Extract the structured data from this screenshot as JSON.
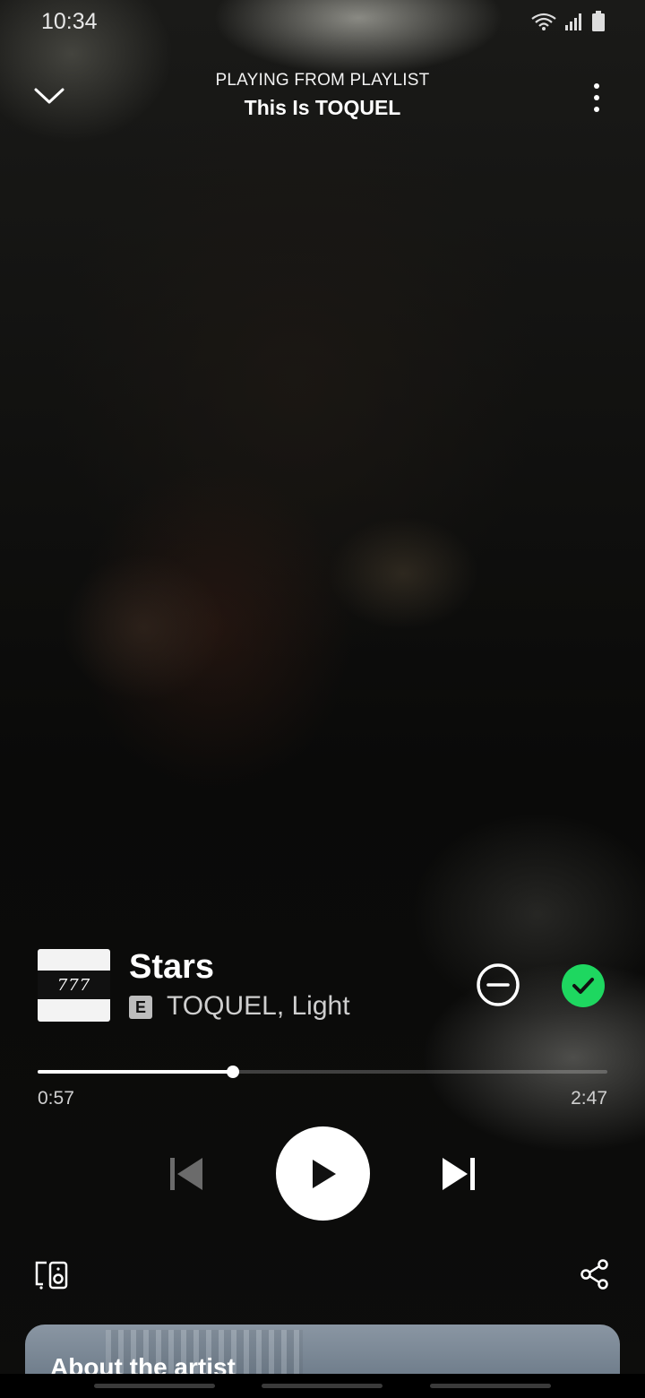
{
  "status_bar": {
    "time": "10:34",
    "icons": [
      "wifi-icon",
      "signal-icon",
      "battery-icon"
    ]
  },
  "header": {
    "context_label": "PLAYING FROM PLAYLIST",
    "context_title": "This Is TOQUEL",
    "collapse_icon": "chevron-down-icon",
    "menu_icon": "more-vertical-icon"
  },
  "track": {
    "art_text": "777",
    "title": "Stars",
    "explicit_badge": "E",
    "artists": "TOQUEL, Light"
  },
  "progress": {
    "elapsed": "0:57",
    "total": "2:47",
    "fraction": 0.342
  },
  "controls": {
    "previous_icon": "skip-previous-icon",
    "play_icon": "play-icon",
    "next_icon": "skip-next-icon",
    "remove_icon": "minus-circle-icon",
    "liked_icon": "check-circle-icon"
  },
  "footer": {
    "devices_icon": "connect-devices-icon",
    "share_icon": "share-icon"
  },
  "about_card": {
    "title": "About the artist"
  },
  "colors": {
    "accent_green": "#1ed760",
    "text_primary": "#ffffff",
    "text_secondary": "#cfcfcf"
  }
}
